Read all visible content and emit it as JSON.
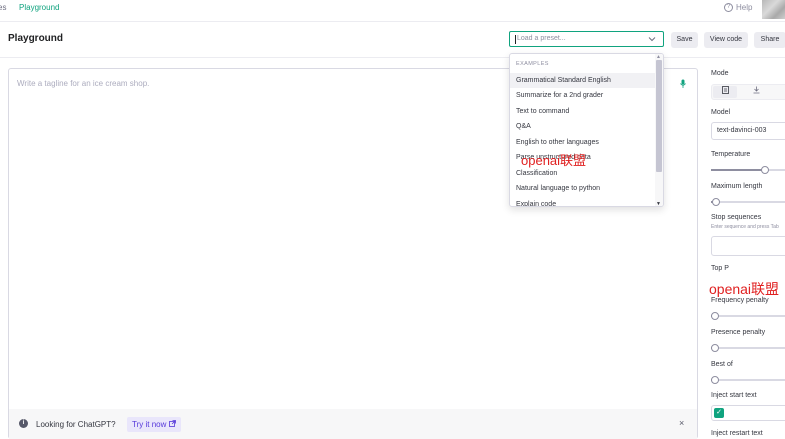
{
  "topnav": {
    "breadcrumb_prev": "es",
    "breadcrumb_current": "Playground",
    "help_label": "Help"
  },
  "header": {
    "title": "Playground",
    "preset_placeholder": "Load a preset...",
    "save_label": "Save",
    "view_code_label": "View code",
    "share_label": "Share"
  },
  "editor": {
    "placeholder": "Write a tagline for an ice cream shop."
  },
  "dropdown": {
    "section": "EXAMPLES",
    "items": [
      "Grammatical Standard English",
      "Summarize for a 2nd grader",
      "Text to command",
      "Q&A",
      "English to other languages",
      "Parse unstructured data",
      "Classification",
      "Natural language to python",
      "Explain code"
    ]
  },
  "banner": {
    "message": "Looking for ChatGPT?",
    "link": "Try it now",
    "close": "×"
  },
  "sidebar": {
    "mode_label": "Mode",
    "model_label": "Model",
    "model_value": "text-davinci-003",
    "temperature_label": "Temperature",
    "temperature_value": 0.7,
    "max_length_label": "Maximum length",
    "max_length_value": 0.02,
    "stop_label": "Stop sequences",
    "stop_hint": "Enter sequence and press Tab",
    "top_p_label": "Top P",
    "frequency_label": "Frequency penalty",
    "frequency_value": 0,
    "presence_label": "Presence penalty",
    "presence_value": 0,
    "best_of_label": "Best of",
    "best_of_value": 0,
    "inject_start_label": "Inject start text",
    "inject_restart_label": "Inject restart text"
  },
  "watermarks": {
    "dropdown": "openai联盟",
    "sidebar": "openai联盟"
  },
  "colors": {
    "accent": "#10a37f",
    "link": "#5436da",
    "watermark": "#e02020"
  }
}
